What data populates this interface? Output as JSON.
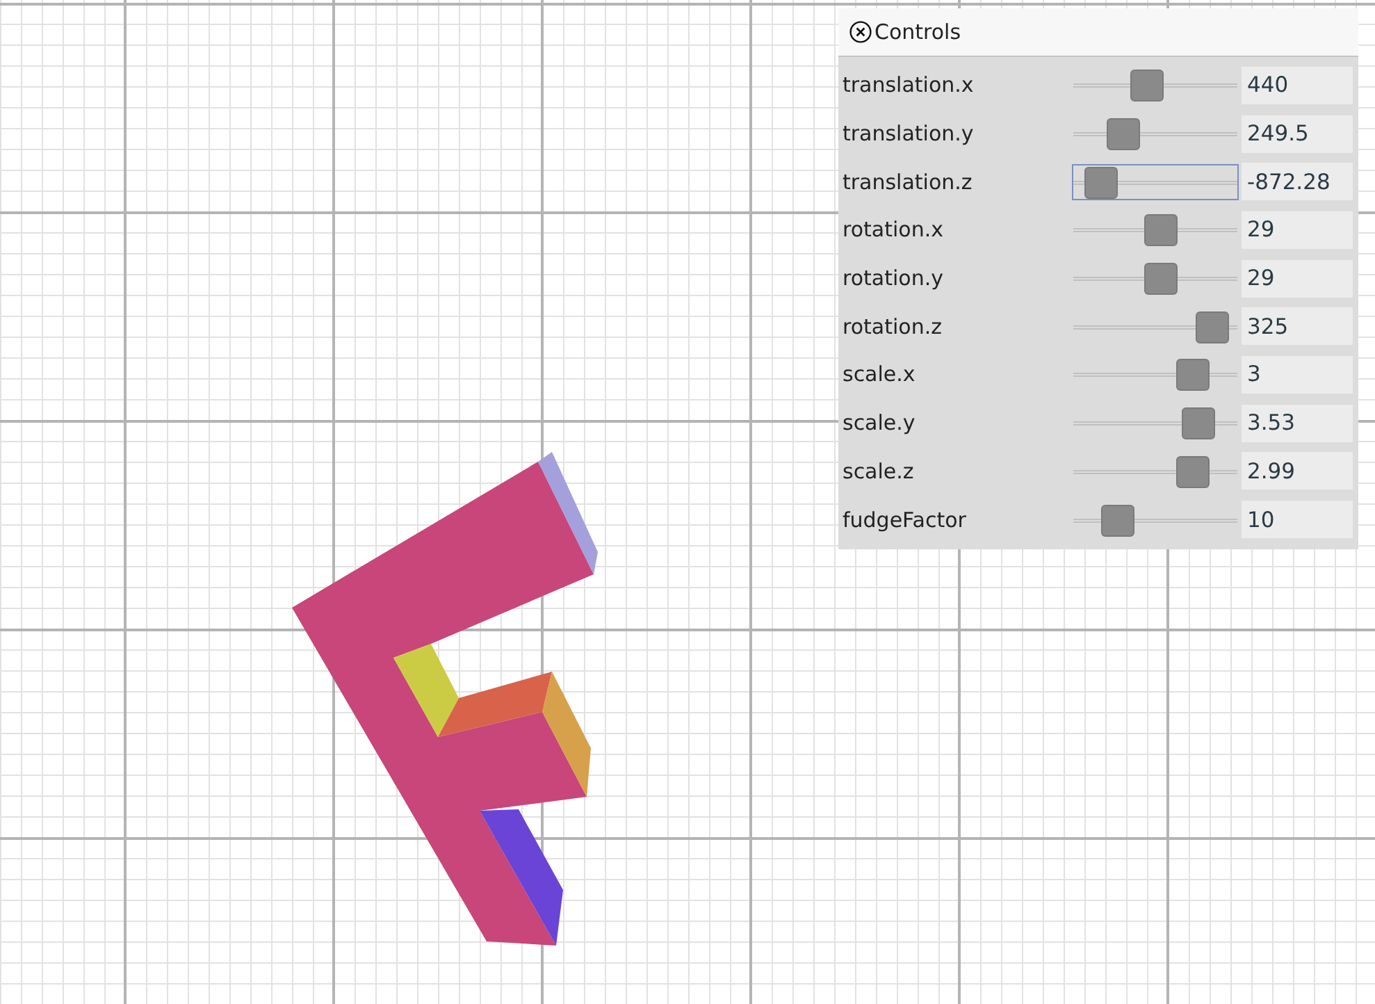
{
  "panel": {
    "title": "Controls"
  },
  "controls": [
    {
      "label": "translation.x",
      "level": 0.44,
      "value": "440",
      "focused": false
    },
    {
      "label": "translation.y",
      "level": 0.26,
      "value": "249.5",
      "focused": false
    },
    {
      "label": "translation.z",
      "level": 0.08,
      "value": "-872.28",
      "focused": true
    },
    {
      "label": "rotation.x",
      "level": 0.54,
      "value": "29",
      "focused": false
    },
    {
      "label": "rotation.y",
      "level": 0.54,
      "value": "29",
      "focused": false
    },
    {
      "label": "rotation.z",
      "level": 0.94,
      "value": "325",
      "focused": false
    },
    {
      "label": "scale.x",
      "level": 0.79,
      "value": "3",
      "focused": false
    },
    {
      "label": "scale.y",
      "level": 0.83,
      "value": "3.53",
      "focused": false
    },
    {
      "label": "scale.z",
      "level": 0.79,
      "value": "2.99",
      "focused": false
    },
    {
      "label": "fudgeFactor",
      "level": 0.21,
      "value": "10",
      "focused": false
    }
  ]
}
